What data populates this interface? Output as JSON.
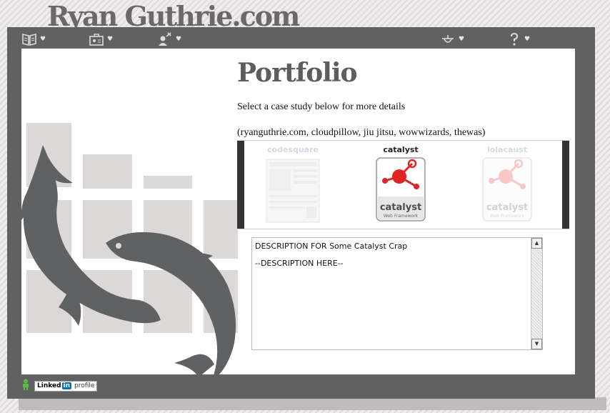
{
  "site": {
    "title": "Ryan Guthrie.com"
  },
  "toolbar": {
    "items": [
      {
        "icon": "book-icon",
        "name": "toolbar-book"
      },
      {
        "icon": "briefcase-icon",
        "name": "toolbar-briefcase"
      },
      {
        "icon": "person-tools-icon",
        "name": "toolbar-person"
      },
      {
        "icon": "plug-icon",
        "name": "toolbar-plug"
      },
      {
        "icon": "question-icon",
        "name": "toolbar-help"
      }
    ],
    "heart": "♥"
  },
  "main": {
    "title": "Portfolio",
    "intro": "Select a case study below for more details",
    "list": "(ryanguthrie.com, cloudpillow, jiu jitsu, wowwizards, thewas)"
  },
  "carousel": {
    "cases": [
      {
        "label": "codesquare",
        "active": false
      },
      {
        "label": "catalyst",
        "active": true,
        "logo_word": "catalyst",
        "logo_sub": "Web Framework"
      },
      {
        "label": "lolacaust",
        "active": false,
        "logo_word": "catalyst",
        "logo_sub": "Web Framework"
      }
    ]
  },
  "description": {
    "line1": "DESCRIPTION FOR Some Catalyst Crap",
    "line2": "--DESCRIPTION HERE--"
  },
  "footer": {
    "linkedin_linked": "Linked",
    "linkedin_in": "in",
    "linkedin_profile": "profile"
  },
  "colors": {
    "frame": "#616161",
    "panel": "#ffffff",
    "tile": "#dcd8d8",
    "fish": "#5f6163",
    "catalyst_red": "#e02424"
  }
}
